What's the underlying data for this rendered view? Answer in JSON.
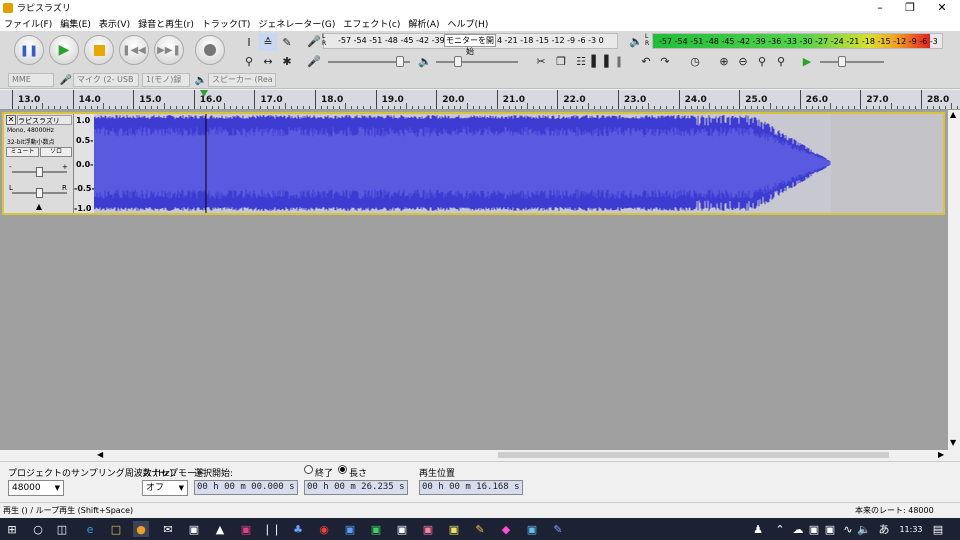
{
  "window": {
    "title": "ラピスラズリ"
  },
  "menu": [
    {
      "label": "ファイル(F)"
    },
    {
      "label": "編集(E)"
    },
    {
      "label": "表示(V)"
    },
    {
      "label": "録音と再生(r)"
    },
    {
      "label": "トラック(T)"
    },
    {
      "label": "ジェネレーター(G)"
    },
    {
      "label": "エフェクト(c)"
    },
    {
      "label": "解析(A)"
    },
    {
      "label": "ヘルプ(H)"
    }
  ],
  "meters": {
    "record_scale": "-57 -54 -51 -48 -45 -42 -39 -3",
    "record_scale_tail": "4 -21 -18 -15 -12 -9 -6 -3 0",
    "monitor_label": "モニターを開始",
    "play_scale": "-57 -54 -51 -48 -45 -42 -39 -36 -33 -30 -27 -24 -21 -18 -15 -12 -9 -6 -3",
    "play_level_fraction": 0.96
  },
  "device": {
    "host": "MME",
    "mic": "マイク (2- USB",
    "channels": "1(モノ)録",
    "speaker": "スピーカー (Rea"
  },
  "ruler": {
    "ticks": [
      "13.0",
      "14.0",
      "15.0",
      "16.0",
      "17.0",
      "18.0",
      "19.0",
      "20.0",
      "21.0",
      "22.0",
      "23.0",
      "24.0",
      "25.0",
      "26.0",
      "27.0",
      "28.0"
    ]
  },
  "track": {
    "name": "ラピスラズリ",
    "info1": "Mono, 48000Hz",
    "info2": "32-bit浮動小数点",
    "mute_label": "ミュート",
    "solo_label": "ソロ",
    "gain_minus": "-",
    "gain_plus": "+",
    "pan_left": "L",
    "pan_right": "R",
    "scale_labels": [
      "1.0",
      "0.5-",
      "0.0-",
      "-0.5-",
      "-1.0"
    ],
    "wave_color": "#3c3cd2",
    "wave_fill_color": "#5a5ae0",
    "playhead_time": 16.168
  },
  "selection": {
    "rate_label": "プロジェクトのサンプリング周波数 (Hz):",
    "rate_value": "48000",
    "snap_label": "スナップモード",
    "snap_value": "オフ",
    "start_label": "選択開始:",
    "end_option": "終了",
    "length_option": "長さ",
    "start_value": "00 h 00 m 00.000 s",
    "length_value": "00 h 00 m 26.235 s",
    "position_label": "再生位置",
    "position_value": "00 h 00 m 16.168 s"
  },
  "status": {
    "left": "再生 () / ループ再生 (Shift+Space)",
    "right": "本来のレート: 48000"
  },
  "taskbar": {
    "ime": "あ",
    "clock": "11:33"
  }
}
